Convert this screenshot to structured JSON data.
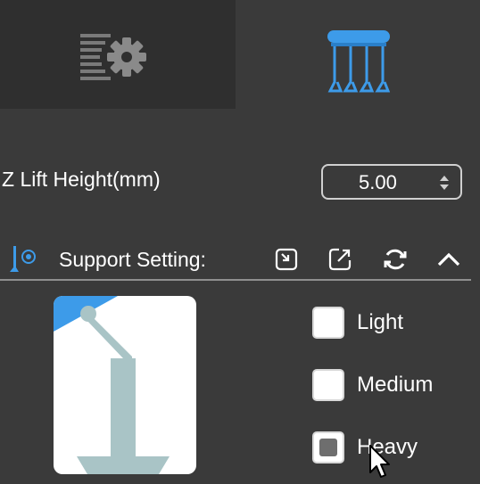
{
  "tabs": [
    {
      "icon": "print-settings-icon",
      "active": false
    },
    {
      "icon": "supports-table-icon",
      "active": true
    }
  ],
  "z_lift": {
    "label": "Z Lift Height(mm)",
    "value": "5.00"
  },
  "support_setting": {
    "title": "Support Setting:",
    "buttons": [
      "import-icon",
      "export-icon",
      "refresh-icon",
      "collapse-icon"
    ]
  },
  "density_options": [
    {
      "label": "Light",
      "checked": false
    },
    {
      "label": "Medium",
      "checked": false
    },
    {
      "label": "Heavy",
      "checked": true
    }
  ],
  "colors": {
    "panel_bg": "#3a3a3a",
    "inactive_tab_bg": "#2f2f2f",
    "accent_blue": "#3d9be9",
    "support_gray": "#a9c4c6"
  }
}
